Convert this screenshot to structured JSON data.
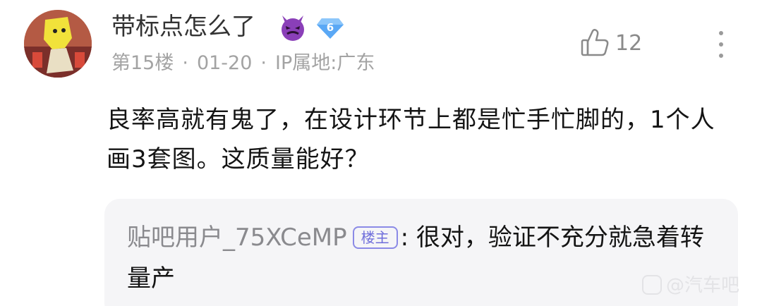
{
  "post": {
    "username": "带标点怎么了",
    "level": "6",
    "floor": "第15楼",
    "date": "01-20",
    "ip_location": "IP属地:广东",
    "separator": "·",
    "like_count": "12",
    "content": "良率高就有鬼了，在设计环节上都是忙手忙脚的，1个人画3套图。这质量能好？"
  },
  "reply": {
    "user": "贴吧用户_75XCeMP",
    "op_badge": "楼主",
    "colon": ":",
    "text": " 很对，验证不充分就急着转量产"
  },
  "watermark": {
    "text": "@汽车吧"
  },
  "icons": {
    "avatar": "avatar-image",
    "emoji": "devil-face-icon",
    "level": "diamond-level-icon",
    "like": "thumbs-up-icon",
    "more": "more-vertical-icon",
    "watermark": "tieba-logo-icon"
  },
  "colors": {
    "accent": "#6f6edb",
    "level_badge": "#5aa8f5",
    "emoji": "#8a3fb8"
  }
}
